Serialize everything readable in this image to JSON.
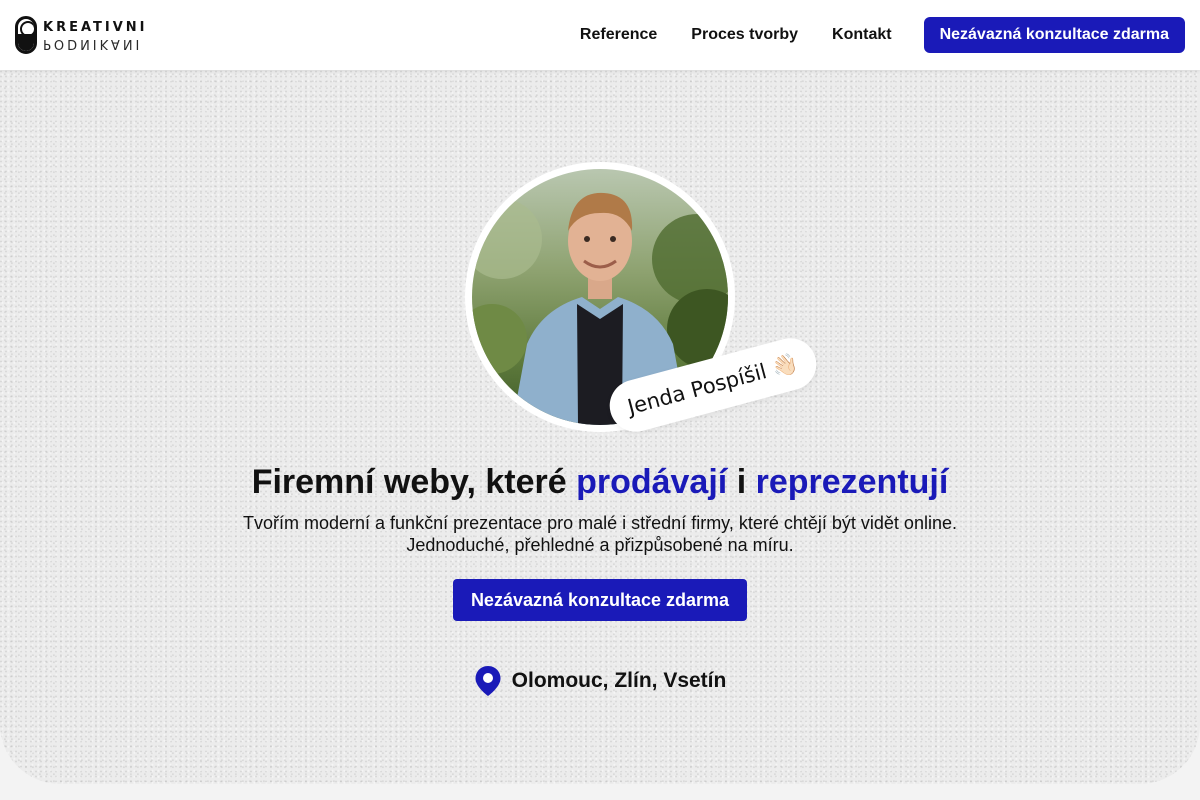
{
  "header": {
    "logo": {
      "top": "KREATIVNI",
      "bottom": "PODNIKANI"
    },
    "nav": [
      {
        "label": "Reference"
      },
      {
        "label": "Proces tvorby"
      },
      {
        "label": "Kontakt"
      }
    ],
    "cta_label": "Nezávazná konzultace zdarma"
  },
  "hero": {
    "name_tag": "Jenda Pospíšil 👋🏻",
    "headline": {
      "part1": "Firemní weby, které ",
      "accent1": "prodávají",
      "part2": " i ",
      "accent2": "reprezentují"
    },
    "subtext_line1": "Tvořím moderní a funkční prezentace pro malé i střední firmy, které chtějí být vidět online.",
    "subtext_line2": "Jednoduché, přehledné a přizpůsobené na míru.",
    "cta_label": "Nezávazná konzultace zdarma",
    "location": "Olomouc, Zlín, Vsetín"
  },
  "colors": {
    "accent": "#1a1ab8",
    "text": "#111111",
    "background": "#ececec"
  },
  "icons": {
    "location": "map-pin-icon",
    "wave": "waving-hand-icon"
  }
}
